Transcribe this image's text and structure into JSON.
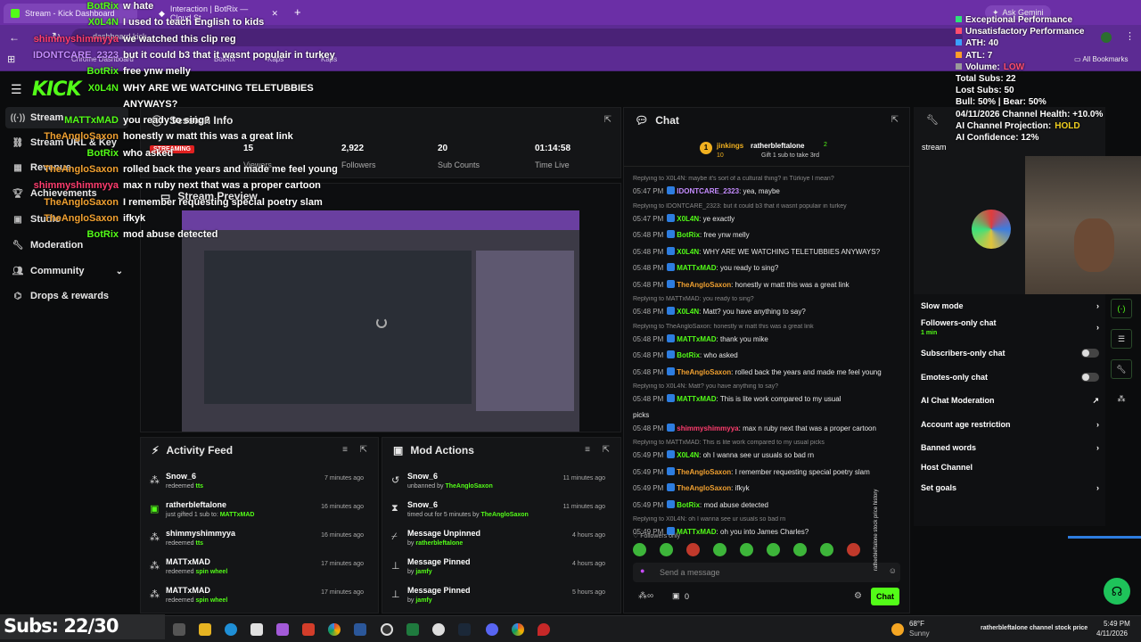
{
  "browser": {
    "tabs": [
      {
        "label": "Stream - Kick Dashboard"
      },
      {
        "label": "Interaction | BotRix — Cloud St"
      }
    ],
    "address": "dashboard.kick",
    "bookmarks": [
      "Chrome Dashboard",
      "BotRix",
      "Kaps",
      "Kaps"
    ],
    "all_bookmarks": "All Bookmarks",
    "ask_gemini": "Ask Gemini"
  },
  "sidebar": {
    "items": [
      {
        "label": "Stream",
        "icon": "broadcast-icon"
      },
      {
        "label": "Stream URL & Key",
        "icon": "link-icon"
      },
      {
        "label": "Revenue",
        "icon": "chart-icon"
      },
      {
        "label": "Achievements",
        "icon": "trophy-icon"
      },
      {
        "label": "Studio",
        "icon": "studio-icon"
      },
      {
        "label": "Moderation",
        "icon": "wrench-icon"
      },
      {
        "label": "Community",
        "icon": "people-icon"
      },
      {
        "label": "Drops & rewards",
        "icon": "gift-icon"
      }
    ]
  },
  "session": {
    "title": "Session Info",
    "live_badge": "STREAMING",
    "stats": [
      {
        "value": "15",
        "label": "Viewers"
      },
      {
        "value": "2,922",
        "label": "Followers"
      },
      {
        "value": "20",
        "label": "Sub Counts"
      },
      {
        "value": "01:14:58",
        "label": "Time Live"
      }
    ]
  },
  "preview": {
    "title": "Stream Preview"
  },
  "activity": {
    "title": "Activity Feed",
    "items": [
      {
        "name": "Snow_6",
        "sub": "redeemed",
        "highlight": "tts",
        "time": "7 minutes ago"
      },
      {
        "name": "ratherbleftalone",
        "sub": "just gifted 1 sub to:",
        "highlight": "MATTxMAD",
        "time": "16 minutes ago"
      },
      {
        "name": "shimmyshimmyya",
        "sub": "redeemed",
        "highlight": "tts",
        "time": "16 minutes ago"
      },
      {
        "name": "MATTxMAD",
        "sub": "redeemed",
        "highlight": "spin wheel",
        "time": "17 minutes ago"
      },
      {
        "name": "MATTxMAD",
        "sub": "redeemed",
        "highlight": "spin wheel",
        "time": "17 minutes ago"
      }
    ]
  },
  "mod": {
    "title": "Mod Actions",
    "items": [
      {
        "name": "Snow_6",
        "sub": "unbanned by",
        "highlight": "TheAngloSaxon",
        "time": "11 minutes ago"
      },
      {
        "name": "Snow_6",
        "sub": "timed out for 5 minutes by",
        "highlight": "TheAngloSaxon",
        "time": "11 minutes ago"
      },
      {
        "name": "Message Unpinned",
        "sub": "by",
        "highlight": "ratherbleftalone",
        "time": "4 hours ago"
      },
      {
        "name": "Message Pinned",
        "sub": "by",
        "highlight": "jamfy",
        "time": "4 hours ago"
      },
      {
        "name": "Message Pinned",
        "sub": "by",
        "highlight": "jamfy",
        "time": "5 hours ago"
      }
    ]
  },
  "chat": {
    "title": "Chat",
    "gifter_left": "jinkings",
    "gifter_left_count": "10",
    "gifter_right": "ratherbleftalone",
    "gifter_right_count": "2",
    "gift_note": "Gift 1 sub to take 3rd",
    "messages": [
      {
        "reply": "Replying to X0L4N: maybe it's sort of a cultural thing? in Türkiye I mean?"
      },
      {
        "time": "05:47 PM",
        "user": "IDONTCARE_2323",
        "text": "yea, maybe",
        "color": "#c58cff"
      },
      {
        "reply": "Replying to IDONTCARE_2323: but it could b3 that it wasnt populair in turkey"
      },
      {
        "time": "05:47 PM",
        "user": "X0L4N",
        "text": "ye exactly",
        "color": "#53fc18"
      },
      {
        "time": "05:48 PM",
        "user": "BotRix",
        "text": "free ynw melly",
        "color": "#53fc18"
      },
      {
        "time": "05:48 PM",
        "user": "X0L4N",
        "text": "WHY ARE WE WATCHING TELETUBBIES ANYWAYS?",
        "color": "#53fc18"
      },
      {
        "time": "05:48 PM",
        "user": "MATTxMAD",
        "text": "you ready to sing?",
        "color": "#53fc18"
      },
      {
        "time": "05:48 PM",
        "user": "TheAngloSaxon",
        "text": "honestly w matt this was a great link",
        "color": "#f0a030"
      },
      {
        "reply": "Replying to MATTxMAD: you ready to sing?"
      },
      {
        "time": "05:48 PM",
        "user": "X0L4N",
        "text": "Matt? you have anything to say?",
        "color": "#53fc18"
      },
      {
        "reply": "Replying to TheAngloSaxon: honestly w matt this was a great link"
      },
      {
        "time": "05:48 PM",
        "user": "MATTxMAD",
        "text": "thank you mike",
        "color": "#53fc18"
      },
      {
        "time": "05:48 PM",
        "user": "BotRix",
        "text": "who asked",
        "color": "#53fc18"
      },
      {
        "time": "05:48 PM",
        "user": "TheAngloSaxon",
        "text": "rolled back the years and made me feel young",
        "color": "#f0a030"
      },
      {
        "reply": "Replying to X0L4N: Matt? you have anything to say?"
      },
      {
        "time": "05:48 PM",
        "user": "MATTxMAD",
        "text": "This is lite work compared to my usual",
        "color": "#53fc18"
      },
      {
        "time": "",
        "user": "",
        "text": "picks",
        "color": "#53fc18"
      },
      {
        "time": "05:48 PM",
        "user": "shimmyshimmyya",
        "text": "max n ruby next that was a proper cartoon",
        "color": "#ff3d6e"
      },
      {
        "reply": "Replying to MATTxMAD: This is lite work compared to my usual picks"
      },
      {
        "time": "05:49 PM",
        "user": "X0L4N",
        "text": "oh I wanna see ur usuals so bad rn",
        "color": "#53fc18"
      },
      {
        "time": "05:49 PM",
        "user": "TheAngloSaxon",
        "text": "I remember requesting special poetry slam",
        "color": "#f0a030"
      },
      {
        "time": "05:49 PM",
        "user": "TheAngloSaxon",
        "text": "ifkyk",
        "color": "#f0a030"
      },
      {
        "time": "05:49 PM",
        "user": "BotRix",
        "text": "mod abuse detected",
        "color": "#53fc18"
      },
      {
        "reply": "Replying to X0L4N: oh I wanna see ur usuals so bad rn"
      },
      {
        "time": "05:49 PM",
        "user": "MATTxMAD",
        "text": "oh you into James Charles?",
        "color": "#53fc18"
      }
    ],
    "followers_only": "Followers only",
    "placeholder": "Send a message",
    "send": "Chat",
    "count": "0"
  },
  "settings": {
    "slow_mode": "Slow mode",
    "followers_only": "Followers-only chat",
    "followers_only_sub": "1 min",
    "subs_only": "Subscribers-only chat",
    "emotes_only": "Emotes-only chat",
    "ai_mod": "AI Chat Moderation",
    "age": "Account age restriction",
    "banned": "Banned words",
    "host": "Host Channel",
    "goals": "Set goals",
    "stream_label": "stream"
  },
  "overlay_chat": [
    {
      "user": "BotRix",
      "text": "w hate",
      "color": "#53fc18"
    },
    {
      "user": "X0L4N",
      "text": "I used to teach English to kids",
      "color": "#53fc18"
    },
    {
      "user": "shimmyshimmyya",
      "text": "we watched this clip reg",
      "color": "#ff3d6e"
    },
    {
      "user": "IDONTCARE_2323",
      "text": "but it could b3 that it wasnt populair in turkey",
      "color": "#c58cff"
    },
    {
      "user": "BotRix",
      "text": "free ynw melly",
      "color": "#53fc18"
    },
    {
      "user": "X0L4N",
      "text": "WHY ARE WE WATCHING TELETUBBIES",
      "color": "#53fc18"
    },
    {
      "user": "",
      "text": "ANYWAYS?",
      "color": "#53fc18"
    },
    {
      "user": "MATTxMAD",
      "text": "you ready to sing?",
      "color": "#53fc18"
    },
    {
      "user": "TheAngloSaxon",
      "text": "honestly w matt this was a great link",
      "color": "#f0a030"
    },
    {
      "user": "BotRix",
      "text": "who asked",
      "color": "#53fc18"
    },
    {
      "user": "TheAngloSaxon",
      "text": "rolled back the years and made me feel young",
      "color": "#f0a030"
    },
    {
      "user": "shimmyshimmyya",
      "text": "max n ruby next that was a proper cartoon",
      "color": "#ff3d6e"
    },
    {
      "user": "TheAngloSaxon",
      "text": "I remember requesting special poetry slam",
      "color": "#f0a030"
    },
    {
      "user": "TheAngloSaxon",
      "text": "ifkyk",
      "color": "#f0a030"
    },
    {
      "user": "BotRix",
      "text": "mod abuse detected",
      "color": "#53fc18"
    }
  ],
  "stats_overlay": [
    {
      "text": "Exceptional Performance",
      "color": "#2fe07a"
    },
    {
      "text": "Unsatisfactory Performance",
      "color": "#ff4d6d"
    },
    {
      "text": "ATH: 40",
      "color": "#3aa0ff"
    },
    {
      "text": "ATL: 7",
      "color": "#ff9c2a"
    },
    {
      "text": "Volume:",
      "extra": "LOW",
      "color": "#9a9a9a"
    },
    {
      "text": "Total Subs: 22",
      "color": ""
    },
    {
      "text": "Lost Subs: 50",
      "color": ""
    },
    {
      "text": "Bull: 50% | Bear: 50%",
      "color": ""
    },
    {
      "text": "04/11/2026 Channel Health: +10.0%",
      "color": ""
    },
    {
      "text": "AI Channel Projection:",
      "extra": "HOLD",
      "color": ""
    },
    {
      "text": "AI Confidence: 12%",
      "color": ""
    }
  ],
  "taskbar": {
    "subs": "Subs: 22/30",
    "weather_temp": "68°F",
    "weather_desc": "Sunny",
    "ticker": "ratherbleftalone channel stock price",
    "time": "5:49 PM",
    "date": "4/11/2026"
  },
  "vertical_label": "ratherbleftalone stock price history",
  "colors": {
    "kick_green": "#53fc18",
    "browser_purple": "#6b2fa6"
  }
}
